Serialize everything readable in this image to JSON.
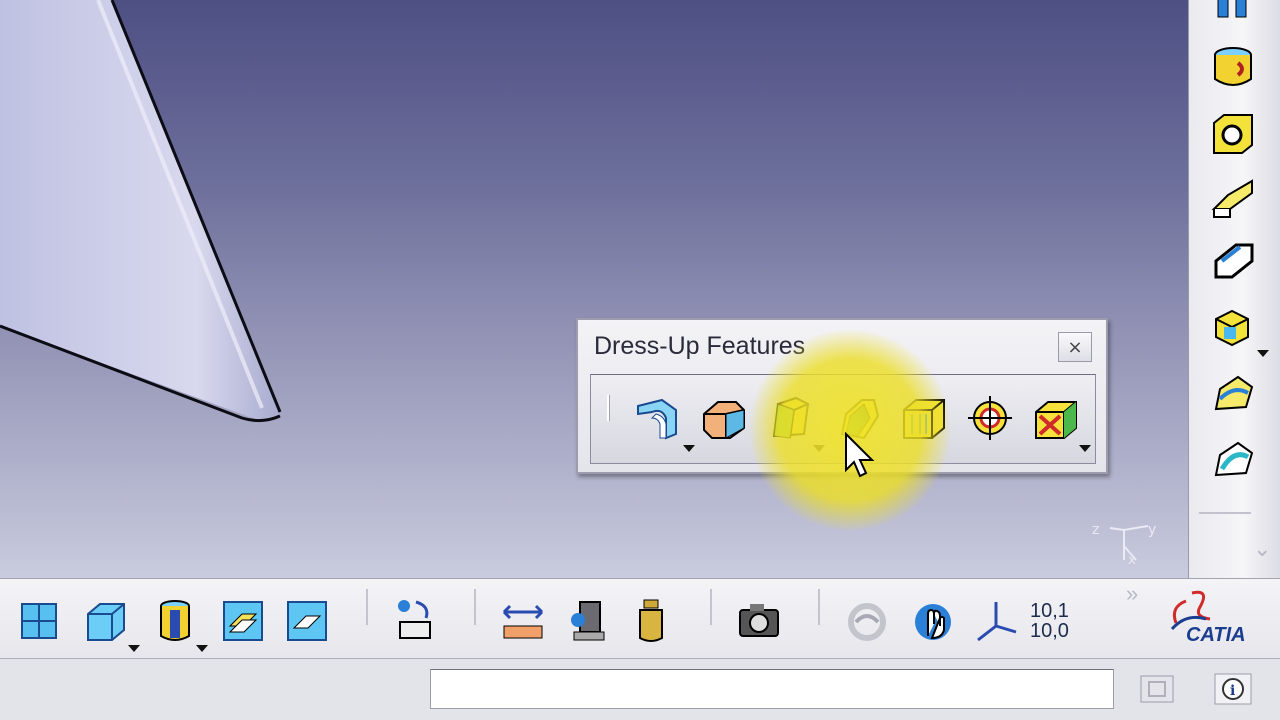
{
  "palette": {
    "title": "Dress-Up Features",
    "close_label": "×",
    "tools": [
      {
        "name": "fillet",
        "icon": "fillet-icon",
        "has_dropdown": true
      },
      {
        "name": "chamfer",
        "icon": "chamfer-icon",
        "has_dropdown": false
      },
      {
        "name": "draft",
        "icon": "draft-angle-icon",
        "has_dropdown": true
      },
      {
        "name": "shell",
        "icon": "shell-icon",
        "has_dropdown": false
      },
      {
        "name": "thickness",
        "icon": "thickness-icon",
        "has_dropdown": false
      },
      {
        "name": "thread",
        "icon": "thread-icon",
        "has_dropdown": false
      },
      {
        "name": "remove-face",
        "icon": "remove-face-icon",
        "has_dropdown": true
      }
    ]
  },
  "bottom_toolbar": {
    "coordinates_line1": "10,1",
    "coordinates_line2": "10,0",
    "brand": "CATIA",
    "overflow": "»"
  },
  "status_bar": {
    "command_value": "",
    "command_placeholder": ""
  },
  "colors": {
    "accent_yellow": "#f2e63a",
    "icon_blue": "#2a7fd6",
    "brand_blue": "#1b3d8f",
    "brand_red": "#d02a2a"
  }
}
